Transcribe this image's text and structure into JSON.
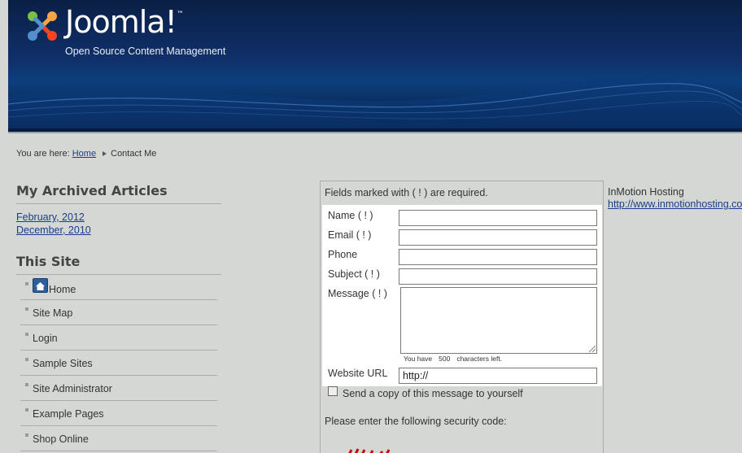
{
  "header": {
    "brand": "Joomla!",
    "tagline": "Open Source Content Management",
    "logo_icon": "joomla-logo-icon"
  },
  "breadcrumb": {
    "prefix": "You are here:",
    "home": "Home",
    "current": "Contact Me"
  },
  "archived": {
    "title": "My Archived Articles",
    "items": [
      "February, 2012",
      "December, 2010"
    ]
  },
  "this_site": {
    "title": "This Site",
    "items": [
      {
        "label": "Home",
        "icon": "home-icon"
      },
      {
        "label": "Site Map"
      },
      {
        "label": "Login"
      },
      {
        "label": "Sample Sites"
      },
      {
        "label": "Site Administrator"
      },
      {
        "label": "Example Pages"
      },
      {
        "label": "Shop Online"
      }
    ]
  },
  "form": {
    "required_note": "Fields marked with ( ! ) are required.",
    "name_label": "Name  ( ! )",
    "email_label": "Email  ( ! )",
    "phone_label": "Phone",
    "subject_label": "Subject  ( ! )",
    "message_label": "Message  ( ! )",
    "chars_prefix": "You have",
    "chars_count": "500",
    "chars_suffix": "characters left.",
    "website_label": "Website URL",
    "website_value": "http://",
    "copy_label": "Send a copy of this message to yourself",
    "security_label": "Please enter the following security code:"
  },
  "sponsor": {
    "name": "InMotion Hosting",
    "url": "http://www.inmotionhosting.com"
  },
  "colors": {
    "header_dark": "#0a1f45",
    "header_blue": "#10306a",
    "page_bg": "#d5d7d4",
    "link": "#1a3d8a",
    "captcha_red": "#cc0000"
  }
}
